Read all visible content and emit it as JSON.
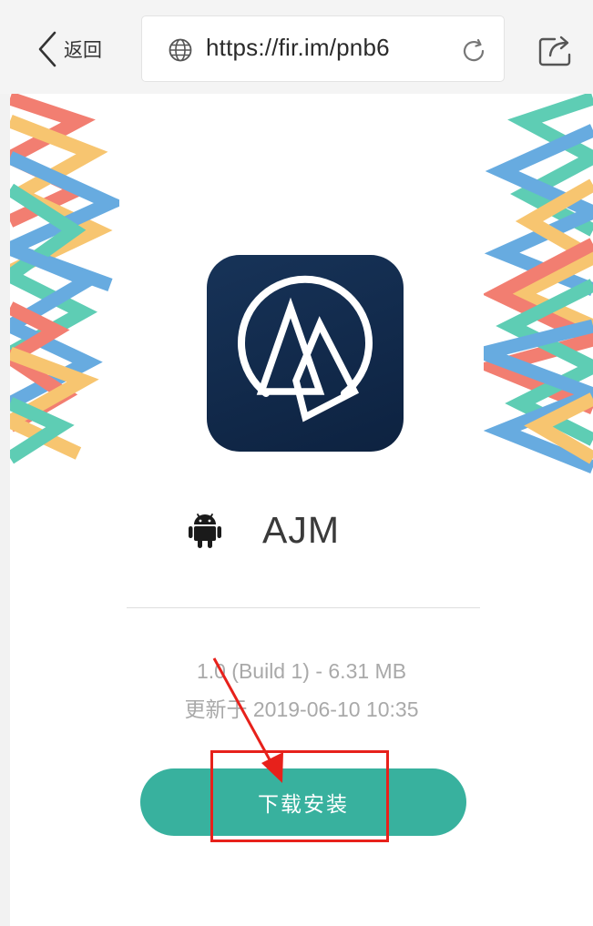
{
  "browser": {
    "back_label": "返回",
    "url": "https://fir.im/pnb6"
  },
  "app": {
    "name": "AJM",
    "version_info": "1.0 (Build 1) - 6.31 MB",
    "updated_info": "更新于 2019-06-10 10:35",
    "download_label": "下载安装"
  },
  "colors": {
    "accent": "#38b19e",
    "annotation": "#e7211b",
    "icon_bg": "#14294b"
  }
}
